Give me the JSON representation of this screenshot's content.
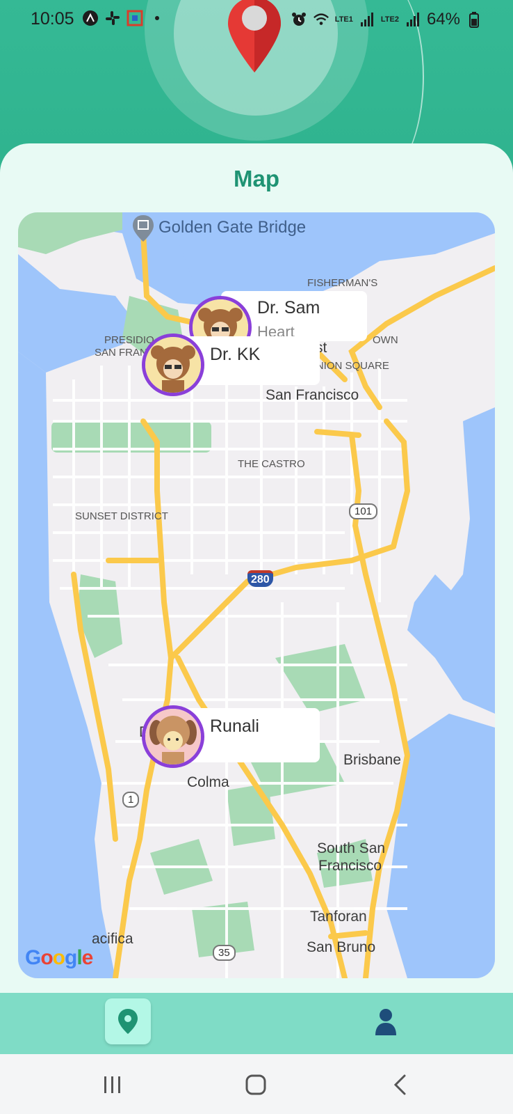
{
  "status_bar": {
    "time": "10:05",
    "battery": "64%",
    "sim1": "LTE1",
    "sim2": "LTE2",
    "left_icons": [
      "a-icon",
      "slack-icon",
      "app-square-icon",
      "dot-icon"
    ],
    "right_icons": [
      "alarm-icon",
      "wifi-icon",
      "signal-icon",
      "signal-icon",
      "battery-icon"
    ]
  },
  "header": {
    "icon": "location-pin-icon",
    "pin_color": "#e53935"
  },
  "card": {
    "title": "Map"
  },
  "map": {
    "labels": {
      "golden_gate": "Golden Gate Bridge",
      "fishermans": "FISHERMAN'S",
      "presidio": "PRESIDIO",
      "san_fran_partial": "SAN FRAN",
      "town_partial": "OWN",
      "st_partial": "st",
      "union_square": "UNION SQUARE",
      "san_francisco": "San Francisco",
      "castro": "THE CASTRO",
      "sunset": "SUNSET DISTRICT",
      "us101": "101",
      "i280": "280",
      "d_partial": "D",
      "brisbane": "Brisbane",
      "colma": "Colma",
      "route1": "1",
      "south_sf_1": "South San",
      "south_sf_2": "Francisco",
      "tanforan": "Tanforan",
      "pacifica_partial": "acifica",
      "san_bruno": "San Bruno",
      "route35": "35",
      "google": "Google"
    },
    "markers": [
      {
        "name": "Dr. Sam",
        "subtitle": "Heart",
        "avatar": "bear-avatar-icon"
      },
      {
        "name": "Dr. KK",
        "subtitle": "",
        "avatar": "bear-avatar-icon"
      },
      {
        "name": "Runali",
        "subtitle": "",
        "avatar": "puppy-avatar-icon"
      }
    ],
    "colors": {
      "water": "#9ec5fb",
      "land": "#f1eff2",
      "park": "#a8dab5",
      "highway": "#fbc94b"
    }
  },
  "bottom_nav": {
    "items": [
      {
        "name": "map",
        "icon": "location-marker-icon",
        "active": true
      },
      {
        "name": "profile",
        "icon": "person-icon",
        "active": false
      }
    ],
    "accent": "#7fdcc6"
  },
  "system_nav": {
    "icons": [
      "recent-apps-icon",
      "home-icon",
      "back-icon"
    ]
  }
}
